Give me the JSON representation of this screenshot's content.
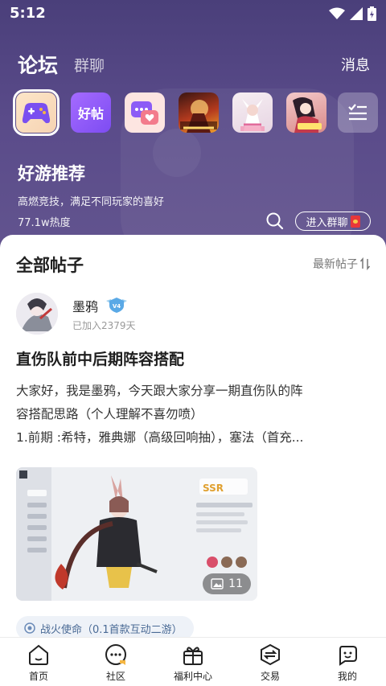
{
  "status": {
    "time": "5:12"
  },
  "nav": {
    "forum": "论坛",
    "group_chat": "群聊",
    "messages": "消息"
  },
  "apps": [
    {
      "name": "game-center",
      "label": ""
    },
    {
      "name": "good-posts",
      "label": "好帖"
    },
    {
      "name": "chat",
      "label": ""
    },
    {
      "name": "game-1",
      "label": ""
    },
    {
      "name": "game-2",
      "label": ""
    },
    {
      "name": "game-3",
      "label": ""
    }
  ],
  "hero": {
    "title": "好游推荐",
    "subtitle": "高燃竞技，满足不同玩家的喜好",
    "heat": "77.1w热度",
    "join_label": "进入群聊"
  },
  "feed": {
    "heading": "全部帖子",
    "sort_label": "最新帖子"
  },
  "post": {
    "author": "墨鸦",
    "joined": "已加入2379天",
    "title": "直伤队前中后期阵容搭配",
    "body_lines": [
      "大家好，我是墨鸦，今天跟大家分享一期直伤队的阵",
      "容搭配思路（个人理解不喜勿喷）",
      "1.前期 :希特，雅典娜（高级回响抽），塞法（首充..."
    ],
    "image_count": "11",
    "tag": "战火使命（0.1首款互动二游）"
  },
  "tabs": [
    {
      "name": "home",
      "label": "首页"
    },
    {
      "name": "community",
      "label": "社区"
    },
    {
      "name": "welfare",
      "label": "福利中心"
    },
    {
      "name": "trade",
      "label": "交易"
    },
    {
      "name": "mine",
      "label": "我的"
    }
  ],
  "colors": {
    "hero_bg": "#5a4b8a",
    "accent_purple": "#8b5cf6"
  }
}
